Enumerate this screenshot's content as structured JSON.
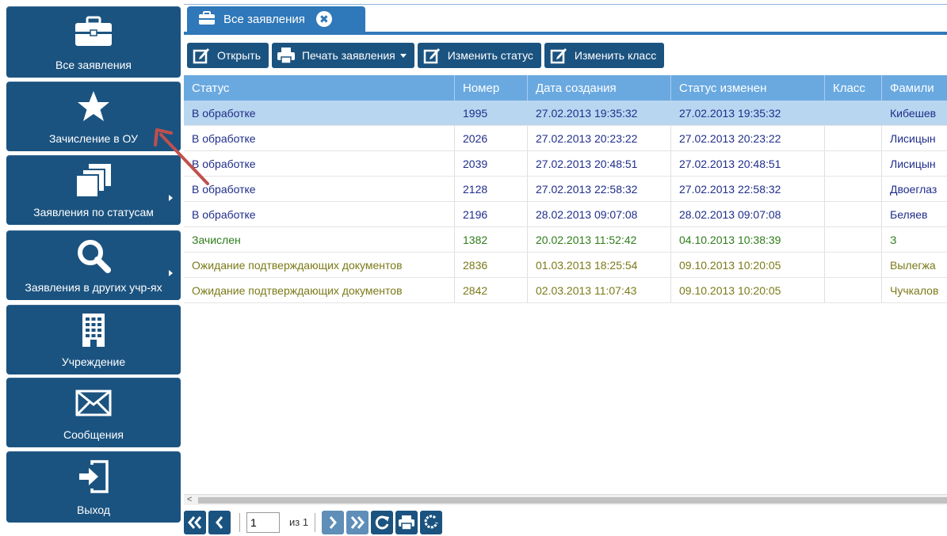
{
  "sidebar": {
    "items": [
      {
        "label": "Все заявления",
        "icon": "briefcase-icon"
      },
      {
        "label": "Зачисление в ОУ",
        "icon": "star-icon"
      },
      {
        "label": "Заявления по статусам",
        "icon": "stacked-pages-icon"
      },
      {
        "label": "Заявления в других учр-ях",
        "icon": "search-icon"
      },
      {
        "label": "Учреждение",
        "icon": "building-icon"
      },
      {
        "label": "Сообщения",
        "icon": "envelope-icon"
      },
      {
        "label": "Выход",
        "icon": "exit-icon"
      }
    ]
  },
  "tab": {
    "label": "Все заявления",
    "close": "✖"
  },
  "toolbar": {
    "open": "Открыть",
    "print": "Печать заявления",
    "change_status": "Изменить статус",
    "change_class": "Изменить класс"
  },
  "grid": {
    "columns": [
      "Статус",
      "Номер",
      "Дата создания",
      "Статус изменен",
      "Класс",
      "Фамили"
    ],
    "rows": [
      {
        "status": "В обработке",
        "num": "1995",
        "created": "27.02.2013 19:35:32",
        "changed": "27.02.2013 19:35:32",
        "class": "",
        "fam": "Кибешев"
      },
      {
        "status": "В обработке",
        "num": "2026",
        "created": "27.02.2013 20:23:22",
        "changed": "27.02.2013 20:23:22",
        "class": "",
        "fam": "Лисицын"
      },
      {
        "status": "В обработке",
        "num": "2039",
        "created": "27.02.2013 20:48:51",
        "changed": "27.02.2013 20:48:51",
        "class": "",
        "fam": "Лисицын"
      },
      {
        "status": "В обработке",
        "num": "2128",
        "created": "27.02.2013 22:58:32",
        "changed": "27.02.2013 22:58:32",
        "class": "",
        "fam": "Двоеглаз"
      },
      {
        "status": "В обработке",
        "num": "2196",
        "created": "28.02.2013 09:07:08",
        "changed": "28.02.2013 09:07:08",
        "class": "",
        "fam": "Беляев"
      },
      {
        "status": "Зачислен",
        "num": "1382",
        "created": "20.02.2013 11:52:42",
        "changed": "04.10.2013 10:38:39",
        "class": "",
        "fam": "З"
      },
      {
        "status": "Ожидание подтверждающих документов",
        "num": "2836",
        "created": "01.03.2013 18:25:54",
        "changed": "09.10.2013 10:20:05",
        "class": "",
        "fam": "Вылегжа"
      },
      {
        "status": "Ожидание подтверждающих документов",
        "num": "2842",
        "created": "02.03.2013 11:07:43",
        "changed": "09.10.2013 10:20:05",
        "class": "",
        "fam": "Чучкалов"
      }
    ]
  },
  "pager": {
    "page": "1",
    "of": "из 1"
  },
  "colors": {
    "sidebar_bg": "#1b5380",
    "tab_bg": "#2f78b9",
    "header_bg": "#6aa9e0",
    "selected_row": "#b9d6f0",
    "status_processing": "#1f2d8a",
    "status_enrolled": "#2e7d1a",
    "status_waiting": "#7a7a18",
    "annotation_arrow": "#c0504d"
  },
  "scroll_left_glyph": "<"
}
